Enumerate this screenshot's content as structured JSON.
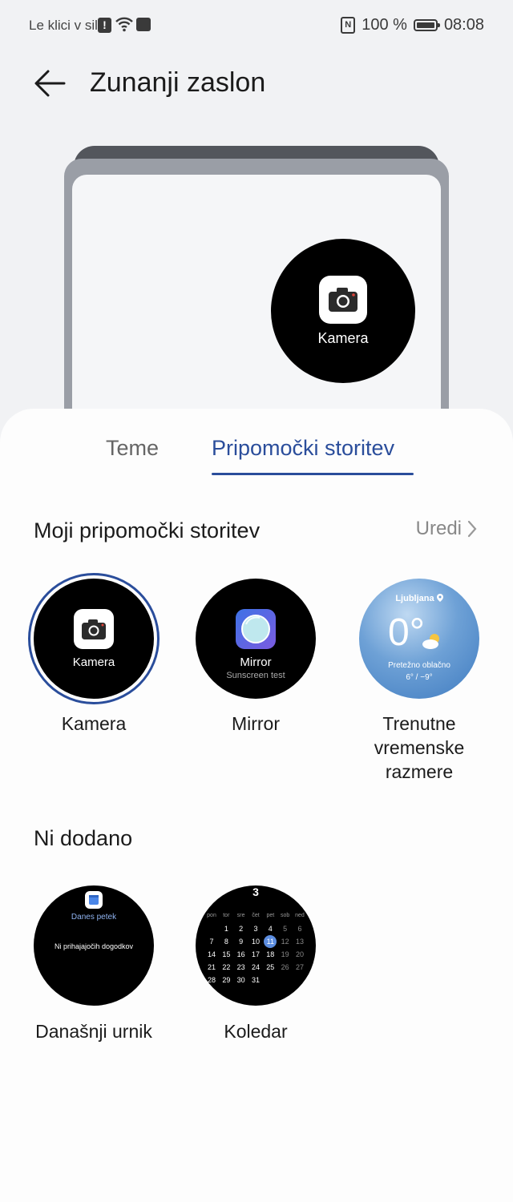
{
  "status_bar": {
    "carrier": "Le klici v sili",
    "nfc": "N",
    "battery": "100 %",
    "time": "08:08"
  },
  "header": {
    "title": "Zunanji zaslon"
  },
  "preview": {
    "widget_label": "Kamera"
  },
  "tabs": [
    {
      "label": "Teme",
      "selected": false
    },
    {
      "label": "Pripomočki storitev",
      "selected": true
    }
  ],
  "my_widgets": {
    "title": "Moji pripomočki storitev",
    "edit_label": "Uredi",
    "items": [
      {
        "inner": "Kamera",
        "label": "Kamera",
        "selected": true
      },
      {
        "inner": "Mirror",
        "inner_sub": "Sunscreen test",
        "label": "Mirror"
      },
      {
        "city": "Ljubljana",
        "temp": "0°",
        "condition": "Pretežno oblačno",
        "range": "6° / −9°",
        "label_lines": [
          "Trenutne",
          "vremenske",
          "razmere"
        ]
      }
    ]
  },
  "not_added": {
    "title": "Ni dodano",
    "schedule": {
      "heading": "Danes petek",
      "message": "Ni prihajajočih dogodkov",
      "label": "Današnji urnik"
    },
    "calendar": {
      "month": "3",
      "weekdays": [
        "pon",
        "tor",
        "sre",
        "čet",
        "pet",
        "sob",
        "ned"
      ],
      "weeks": [
        [
          "",
          "1",
          "2",
          "3",
          "4",
          "5",
          "6"
        ],
        [
          "7",
          "8",
          "9",
          "10",
          "11",
          "12",
          "13"
        ],
        [
          "14",
          "15",
          "16",
          "17",
          "18",
          "19",
          "20"
        ],
        [
          "21",
          "22",
          "23",
          "24",
          "25",
          "26",
          "27"
        ],
        [
          "28",
          "29",
          "30",
          "31",
          "",
          "",
          ""
        ]
      ],
      "today": "11",
      "label": "Koledar"
    }
  },
  "colors": {
    "accent": "#2a4d9b",
    "background": "#f1f2f4",
    "sheet": "#fdfdfd"
  }
}
